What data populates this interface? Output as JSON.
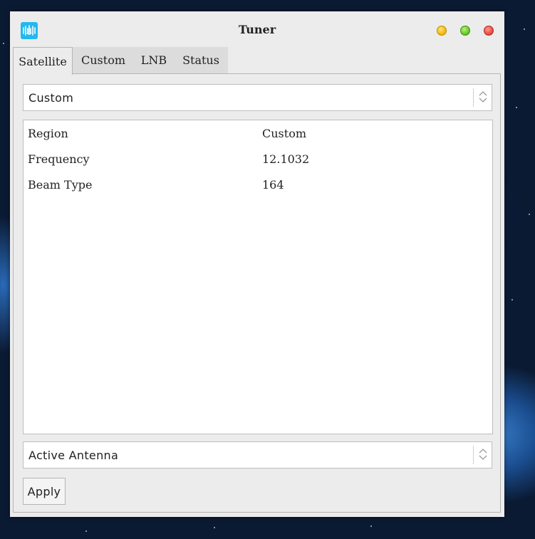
{
  "window": {
    "title": "Tuner",
    "icon": "tuner-app-icon"
  },
  "tabs": [
    {
      "label": "Satellite",
      "active": true
    },
    {
      "label": "Custom",
      "active": false
    },
    {
      "label": "LNB",
      "active": false
    },
    {
      "label": "Status",
      "active": false
    }
  ],
  "satellite_select": {
    "value": "Custom"
  },
  "properties": [
    {
      "key": "Region",
      "value": "Custom"
    },
    {
      "key": "Frequency",
      "value": "12.1032"
    },
    {
      "key": "Beam Type",
      "value": "164"
    }
  ],
  "antenna_select": {
    "value": "Active Antenna"
  },
  "apply_label": "Apply",
  "colors": {
    "minimize": "#f0b400",
    "maximize": "#5bc21c",
    "close": "#e0463a",
    "app_icon": "#22b8f0"
  }
}
